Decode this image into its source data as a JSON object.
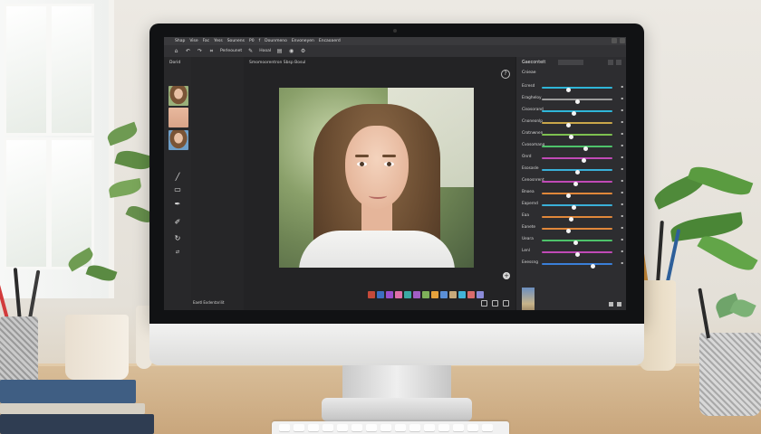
{
  "menubar": {
    "items": [
      "Shap",
      "Vise",
      "Fac",
      "Yess",
      "Sounens",
      "P0",
      "f",
      "Dounmeno",
      "Envoneyen",
      "Encaoaerd"
    ]
  },
  "toolbar": {
    "labels": [
      "Perleounet",
      "Hooal"
    ],
    "icons": [
      "home-icon",
      "undo-icon",
      "redo-icon",
      "crop-icon",
      "brush-icon",
      "layers-icon",
      "eye-icon",
      "settings-icon"
    ]
  },
  "left_tools": {
    "header": "Dorid",
    "thumbnails": [
      "portrait-thumb-1",
      "skin-thumb",
      "portrait-thumb-2"
    ],
    "tools": [
      "line-tool-icon",
      "marquee-tool-icon",
      "pen-tool-icon",
      "brush-tool-icon",
      "history-brush-icon"
    ]
  },
  "canvas": {
    "doc_tab": "Smomoorentron  Sbsp  Bosul",
    "help_symbol": "?",
    "add_symbol": "+"
  },
  "layers_footer": "Eaetl Exdentarilit",
  "adjust_panel": {
    "title": "Gaeconteit",
    "selector": "Cnieae",
    "rows": [
      {
        "label": "Ecresd",
        "value": 0.38,
        "color": "#2fb6d8"
      },
      {
        "label": "Eragheloy",
        "value": 0.5,
        "color": "#9c9c9c"
      },
      {
        "label": "Cisosorand",
        "value": 0.45,
        "color": "#2fb6d8"
      },
      {
        "label": "Cnoneonlp",
        "value": 0.38,
        "color": "#c9a64a"
      },
      {
        "label": "Crotnwnen",
        "value": 0.42,
        "color": "#7ec050"
      },
      {
        "label": "Cvosomang",
        "value": 0.62,
        "color": "#4ec36a"
      },
      {
        "label": "Onrd",
        "value": 0.6,
        "color": "#c04ab6"
      },
      {
        "label": "Esosasle",
        "value": 0.5,
        "color": "#3ab0d8"
      },
      {
        "label": "Cenosnrent",
        "value": 0.48,
        "color": "#c04ab6"
      },
      {
        "label": "Bnoea",
        "value": 0.38,
        "color": "#e0873a"
      },
      {
        "label": "Eapernd",
        "value": 0.45,
        "color": "#3ab0d8"
      },
      {
        "label": "Eaa",
        "value": 0.42,
        "color": "#e0873a"
      },
      {
        "label": "Eanete",
        "value": 0.38,
        "color": "#e0873a"
      },
      {
        "label": "Ueara",
        "value": 0.48,
        "color": "#4ec36a"
      },
      {
        "label": "Lenl",
        "value": 0.5,
        "color": "#c04ab6"
      },
      {
        "label": "Eeessng",
        "value": 0.72,
        "color": "#3a7fd8"
      }
    ]
  },
  "filmstrip_colors": [
    "#c54a3a",
    "#3c6fc2",
    "#9a4fcf",
    "#e06fa8",
    "#3ba9a4",
    "#a15ec4",
    "#7fb05a",
    "#e6a23c",
    "#5b8fd6",
    "#c8a97a",
    "#42b3d8",
    "#d96b6b",
    "#8a8ad8"
  ]
}
